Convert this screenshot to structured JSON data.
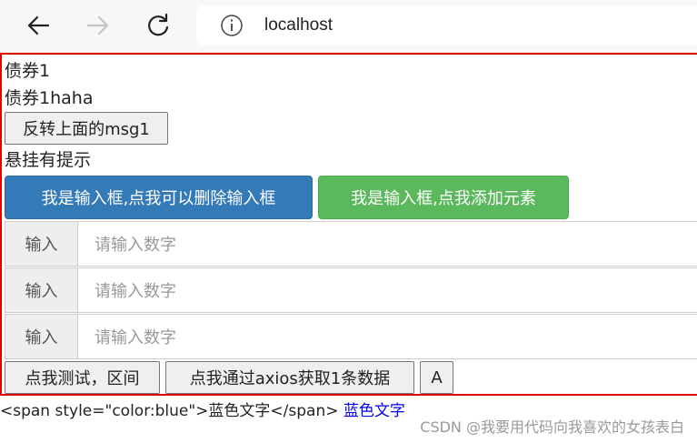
{
  "browser": {
    "url": "localhost",
    "icons": [
      "back-arrow-icon",
      "forward-arrow-icon",
      "reload-icon",
      "info-icon"
    ]
  },
  "app": {
    "line1": "债券1",
    "line2": "债券1haha",
    "reverse_button": "反转上面的msg1",
    "hover_text": "悬挂有提示",
    "primary_button": "我是输入框,点我可以删除输入框",
    "success_button": "我是输入框,点我添加元素",
    "inputs": [
      {
        "addon": "输入",
        "placeholder": "请输入数字"
      },
      {
        "addon": "输入",
        "placeholder": "请输入数字"
      },
      {
        "addon": "输入",
        "placeholder": "请输入数字"
      }
    ],
    "test_button": "点我测试，区间",
    "axios_button": "点我通过axios获取1条数据",
    "a_button": "A",
    "border_color": "#e00000",
    "primary_color": "#337ab7",
    "success_color": "#5cb85c"
  },
  "footer": {
    "raw_html_text": "<span style=\"color:blue\">蓝色文字</span>",
    "blue_text": "蓝色文字"
  },
  "watermark": "CSDN @我要用代码向我喜欢的女孩表白"
}
